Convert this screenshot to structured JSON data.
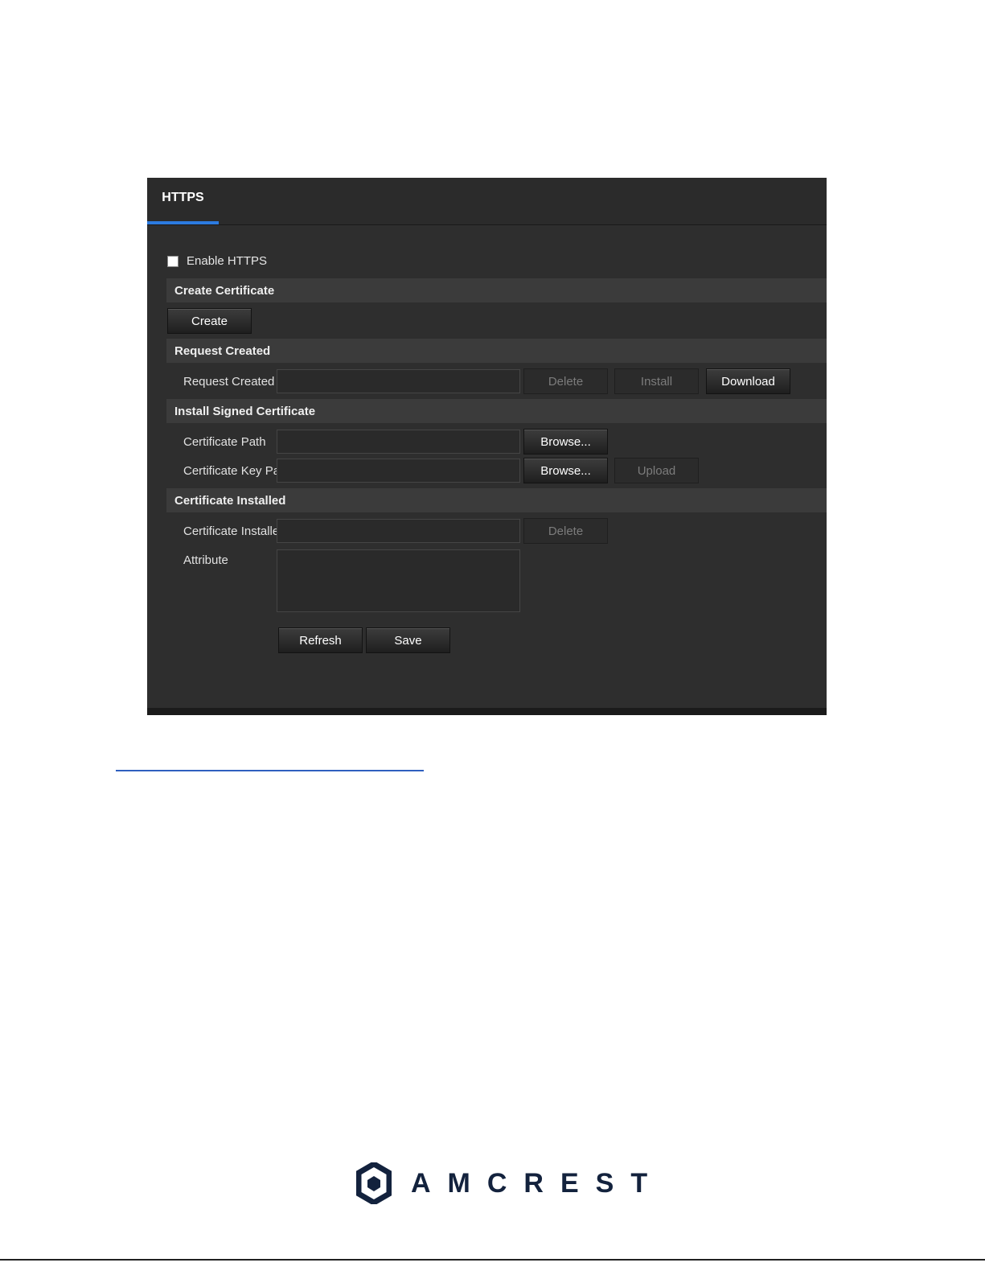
{
  "tab": {
    "label": "HTTPS"
  },
  "enable": {
    "label": "Enable HTTPS",
    "checked": false
  },
  "sections": {
    "create": "Create Certificate",
    "request": "Request Created",
    "install": "Install Signed Certificate",
    "installed": "Certificate Installed"
  },
  "buttons": {
    "create": "Create",
    "delete": "Delete",
    "install": "Install",
    "download": "Download",
    "browse": "Browse...",
    "upload": "Upload",
    "refresh": "Refresh",
    "save": "Save"
  },
  "fields": {
    "request_created": {
      "label": "Request Created",
      "value": ""
    },
    "certificate_path": {
      "label": "Certificate Path",
      "value": ""
    },
    "certificate_key_path": {
      "label": "Certificate Key Path",
      "value": ""
    },
    "certificate_installed": {
      "label": "Certificate Installed",
      "value": ""
    },
    "attribute": {
      "label": "Attribute",
      "value": ""
    }
  },
  "logo": {
    "text": "AMCREST"
  },
  "colors": {
    "accent": "#2c7be0",
    "panel": "#2e2e2e",
    "brand": "#13223d"
  }
}
